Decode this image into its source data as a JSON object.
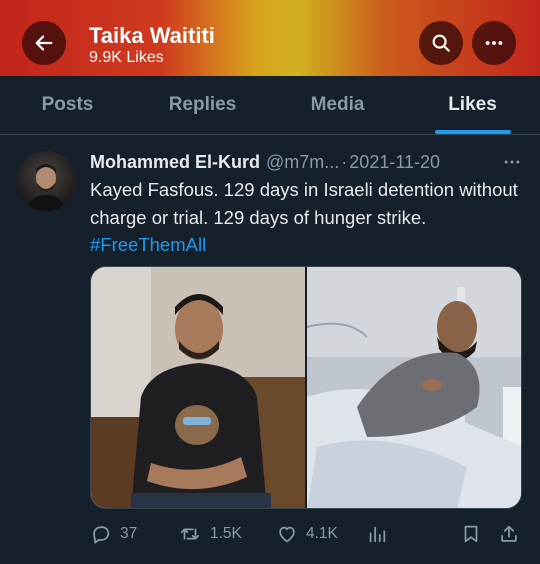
{
  "header": {
    "title": "Taika Waititi",
    "subtitle": "9.9K Likes"
  },
  "tabs": [
    {
      "label": "Posts"
    },
    {
      "label": "Replies"
    },
    {
      "label": "Media"
    },
    {
      "label": "Likes"
    }
  ],
  "active_tab": "Likes",
  "tweet": {
    "author_name": "Mohammed El-Kurd",
    "handle": "@m7m...",
    "separator": "·",
    "date": "2021-11-20",
    "text": "Kayed Fasfous. 129 days in Israeli detention without charge or trial. 129 days of hunger strike.",
    "hashtag": "#FreeThemAll",
    "stats": {
      "replies": "37",
      "retweets": "1.5K",
      "likes": "4.1K"
    }
  },
  "icons": {
    "back": "arrow-left-icon",
    "search": "search-icon",
    "more": "more-horizontal-icon",
    "reply": "comment-icon",
    "retweet": "retweet-icon",
    "like": "heart-icon",
    "views": "bar-chart-icon",
    "bookmark": "bookmark-icon",
    "share": "share-icon"
  },
  "colors": {
    "background": "#15202b",
    "accent": "#1d9bf0",
    "muted": "#8b98a5",
    "text": "#e7e9ea"
  }
}
